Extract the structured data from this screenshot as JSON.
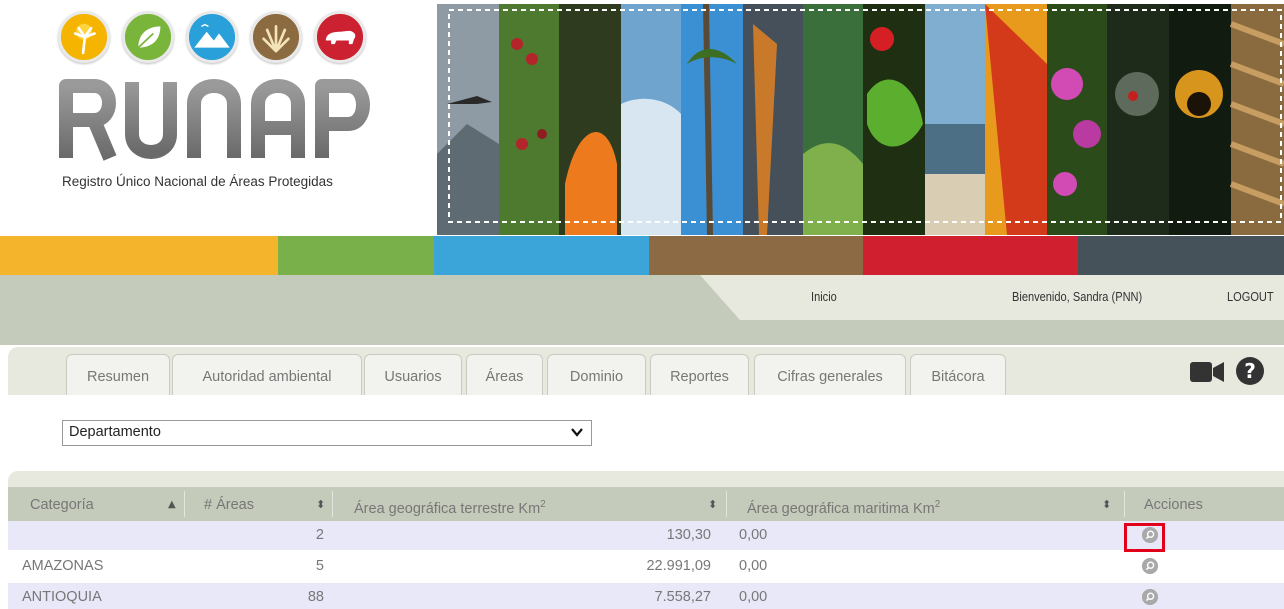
{
  "logo": {
    "wordmark": "RUNAP",
    "subtitle": "Registro Único Nacional de Áreas Protegidas",
    "circles": [
      {
        "icon": "palm-tree-icon",
        "color": "#f0a800"
      },
      {
        "icon": "leaf-icon",
        "color": "#78b43a"
      },
      {
        "icon": "mountain-icon",
        "color": "#2ea2d9"
      },
      {
        "icon": "grass-icon",
        "color": "#8a6a3f"
      },
      {
        "icon": "bear-icon",
        "color": "#c8202f"
      }
    ]
  },
  "color_strip": [
    "#f4b52c",
    "#79b04a",
    "#3ba4d8",
    "#8c6a44",
    "#d0202f",
    "#45525a"
  ],
  "nav": {
    "inicio": "Inicio",
    "welcome": "Bienvenido, Sandra (PNN)",
    "logout": "LOGOUT"
  },
  "tabs": [
    "Resumen",
    "Autoridad ambiental",
    "Usuarios",
    "Áreas",
    "Dominio",
    "Reportes",
    "Cifras generales",
    "Bitácora"
  ],
  "toolbar_icons": {
    "video": "video-camera-icon",
    "help": "help-icon"
  },
  "filter": {
    "selected": "Departamento"
  },
  "table": {
    "columns": {
      "categoria": "Categoría",
      "num_areas": "# Áreas",
      "terrestre": "Área geográfica terrestre Km",
      "terrestre_sup": "2",
      "maritima": "Área geográfica maritima Km",
      "maritima_sup": "2",
      "acciones": "Acciones"
    },
    "rows": [
      {
        "categoria": "",
        "num_areas": "2",
        "terrestre": "130,30",
        "maritima": "0,00"
      },
      {
        "categoria": "AMAZONAS",
        "num_areas": "5",
        "terrestre": "22.991,09",
        "maritima": "0,00"
      },
      {
        "categoria": "ANTIOQUIA",
        "num_areas": "88",
        "terrestre": "7.558,27",
        "maritima": "0,00"
      }
    ],
    "action_icon": "search-icon"
  },
  "colors": {
    "nav_dark": "#c5cbbb",
    "nav_light": "#e7e9df",
    "row_odd": "#e8e8f8",
    "highlight": "#e3001b"
  }
}
